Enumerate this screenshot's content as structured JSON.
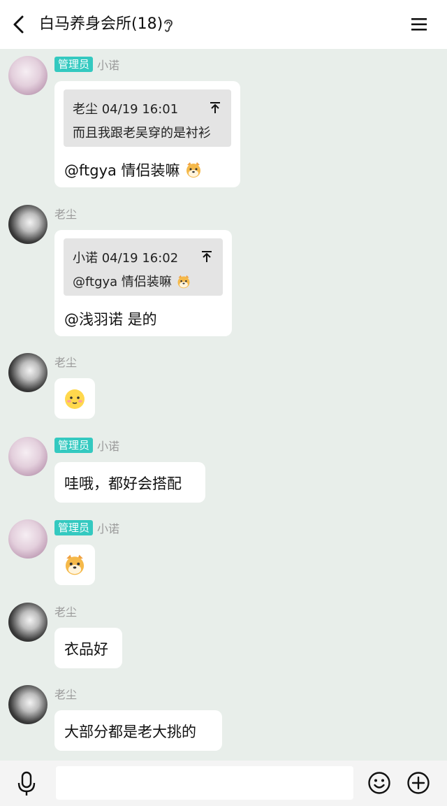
{
  "header": {
    "title": "白马养身会所(18)"
  },
  "badge_label": "管理员",
  "messages": [
    {
      "sender": "小诺",
      "quote_author_time": "老尘 04/19 16:01",
      "quote_text": "而且我跟老吴穿的是衬衫",
      "text": "@ftgya 情侣装嘛"
    },
    {
      "sender": "老尘",
      "quote_author_time": "小诺 04/19 16:02",
      "quote_text": "@ftgya 情侣装嘛",
      "text": "@浅羽诺 是的"
    },
    {
      "sender": "老尘"
    },
    {
      "sender": "小诺",
      "text": "哇哦，都好会搭配"
    },
    {
      "sender": "小诺"
    },
    {
      "sender": "老尘",
      "text": "衣品好"
    },
    {
      "sender": "老尘",
      "text": "大部分都是老大挑的"
    }
  ],
  "input": {
    "placeholder": ""
  },
  "colors": {
    "background": "#e8eeea",
    "badge": "#34c9c0",
    "bubble": "#ffffff",
    "quote": "#e4e4e4"
  }
}
